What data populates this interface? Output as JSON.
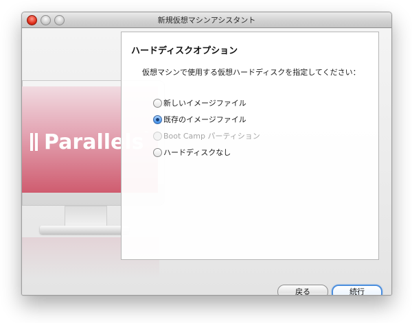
{
  "window": {
    "title": "新規仮想マシンアシスタント"
  },
  "branding": {
    "logo_text": "Parallels",
    "logo_mark": "™"
  },
  "panel": {
    "title": "ハードディスクオプション",
    "instruction": "仮想マシンで使用する仮想ハードディスクを指定してください：",
    "options": [
      {
        "label": "新しいイメージファイル",
        "checked": false,
        "enabled": true
      },
      {
        "label": "既存のイメージファイル",
        "checked": true,
        "enabled": true
      },
      {
        "label": "Boot Camp パーティション",
        "checked": false,
        "enabled": false
      },
      {
        "label": "ハードディスクなし",
        "checked": false,
        "enabled": true
      }
    ]
  },
  "buttons": {
    "back": "戻る",
    "next": "続行"
  },
  "colors": {
    "accent": "#4b8ede",
    "close": "#e0301c",
    "screen_pink": "#cf5c6f"
  }
}
